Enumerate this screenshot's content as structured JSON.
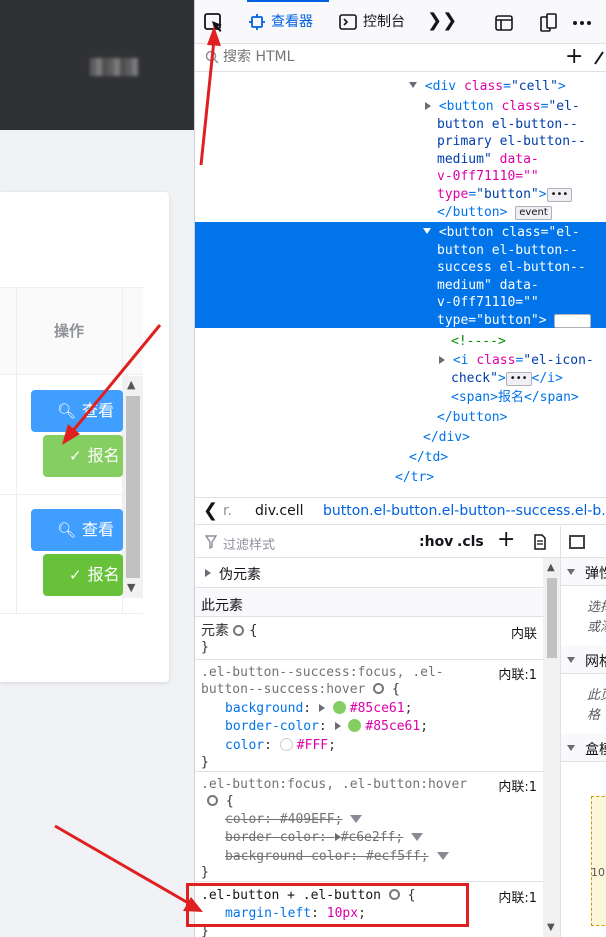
{
  "page": {
    "table": {
      "header_op": "操作",
      "rows": [
        {
          "view_label": "查看",
          "signup_label": "报名"
        },
        {
          "view_label": "查看",
          "signup_label": "报名"
        }
      ]
    }
  },
  "devtools": {
    "tabs": {
      "inspector": "查看器",
      "console": "控制台"
    },
    "search_placeholder": "搜索 HTML",
    "markup": {
      "l_cell_div": "<div class=\"cell\">",
      "btn1": [
        "<button class=\"el-",
        "button el-button--",
        "primary el-button--",
        "medium\" data-",
        "v-0ff71110=\"\"",
        "type=\"button\">"
      ],
      "btn1_close": "</button>",
      "btn2": [
        "<button class=\"el-",
        "button el-button--",
        "success el-button--",
        "medium\" data-",
        "v-0ff71110=\"\"",
        "type=\"button\">"
      ],
      "comment": "<!---->",
      "icon": [
        "<i class=\"el-icon-",
        "check\">"
      ],
      "icon_close": "</i>",
      "span": "<span>报名</span>",
      "btn2_close": "</button>",
      "div_close": "</div>",
      "td_close": "</td>",
      "tr_close": "</tr>",
      "event_badge": "event",
      "dots_badge": "•••"
    },
    "breadcrumbs": [
      "r.",
      "div.cell",
      "button.el-button.el-button--success.el-b..."
    ],
    "rules": {
      "filter_placeholder": "过滤样式",
      "hov": ":hov",
      "cls": ".cls",
      "pseudo_elements": "伪元素",
      "this_element": "此元素",
      "element_rule": {
        "selector": "元素",
        "source": "内联"
      },
      "rule1": {
        "selector_a": ".el-button--success:focus, .el-",
        "selector_b": "button--success:hover",
        "source": "内联:1",
        "decls": [
          {
            "name": "background",
            "value": "#85ce61",
            "color": "#85ce61"
          },
          {
            "name": "border-color",
            "value": "#85ce61",
            "color": "#85ce61"
          },
          {
            "name": "color",
            "value": "#FFF",
            "color": "#ffffff"
          }
        ]
      },
      "rule2": {
        "selector": ".el-button:focus, .el-button:hover",
        "source": "内联:1",
        "decls": [
          {
            "name": "color",
            "value": "#409EFF"
          },
          {
            "name": "border-color",
            "value": "#c6e2ff"
          },
          {
            "name": "background-color",
            "value": "#ecf5ff"
          }
        ]
      },
      "rule3": {
        "selector": ".el-button + .el-button",
        "source": "内联:1",
        "decls": [
          {
            "name": "margin-left",
            "value": "10px"
          }
        ]
      }
    },
    "side": {
      "sections": [
        "弹性",
        "网格",
        "盒模型"
      ],
      "flex_text": [
        "选择",
        "或添"
      ],
      "grid_text": [
        "此页",
        "格"
      ],
      "box_num": "10"
    }
  },
  "colors": {
    "primary": "#409eff",
    "success": "#67c23a",
    "success_hover": "#85ce61",
    "devtools_accent": "#0061e0",
    "annotation_red": "#e02020"
  }
}
